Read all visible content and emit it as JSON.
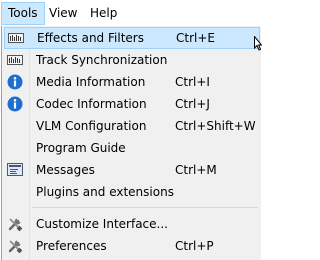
{
  "menubar": {
    "items": [
      {
        "label": "Tools"
      },
      {
        "label": "View"
      },
      {
        "label": "Help"
      }
    ]
  },
  "tools_menu": {
    "items": [
      {
        "label": "Effects and Filters",
        "shortcut": "Ctrl+E",
        "icon": "equalizer-icon"
      },
      {
        "label": "Track Synchronization",
        "shortcut": "",
        "icon": "equalizer-icon"
      },
      {
        "label": "Media Information",
        "shortcut": "Ctrl+I",
        "icon": "info-icon"
      },
      {
        "label": "Codec Information",
        "shortcut": "Ctrl+J",
        "icon": "info-icon"
      },
      {
        "label": "VLM Configuration",
        "shortcut": "Ctrl+Shift+W",
        "icon": ""
      },
      {
        "label": "Program Guide",
        "shortcut": "",
        "icon": ""
      },
      {
        "label": "Messages",
        "shortcut": "Ctrl+M",
        "icon": "messages-icon"
      },
      {
        "label": "Plugins and extensions",
        "shortcut": "",
        "icon": ""
      },
      {
        "label": "Customize Interface...",
        "shortcut": "",
        "icon": "tools-icon"
      },
      {
        "label": "Preferences",
        "shortcut": "Ctrl+P",
        "icon": "tools-icon"
      }
    ],
    "highlighted_item": "Effects and Filters"
  },
  "colors": {
    "highlight_bg": "#cce8ff",
    "highlight_border": "#99d1ff",
    "menu_bg": "#f0f0f0",
    "info_blue": "#1c6fd0"
  }
}
